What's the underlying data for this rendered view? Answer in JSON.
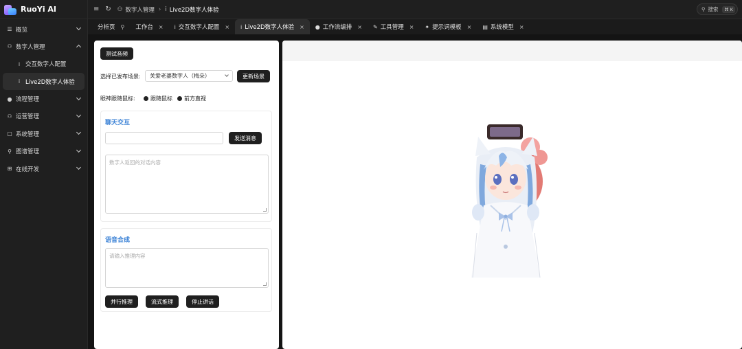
{
  "app": {
    "name": "RuoYi AI"
  },
  "sidebar": {
    "items": [
      {
        "label": "概览",
        "icon": "list-icon"
      },
      {
        "label": "数字人管理",
        "icon": "users-icon",
        "expanded": true
      },
      {
        "label": "交互数字人配置",
        "icon": "person-icon",
        "sub": true
      },
      {
        "label": "Live2D数字人体验",
        "icon": "person-icon",
        "sub": true,
        "active": true
      },
      {
        "label": "流程管理",
        "icon": "user-icon"
      },
      {
        "label": "运营管理",
        "icon": "team-icon"
      },
      {
        "label": "系统管理",
        "icon": "system-icon"
      },
      {
        "label": "图谱管理",
        "icon": "graph-icon"
      },
      {
        "label": "在线开发",
        "icon": "code-icon"
      }
    ]
  },
  "header": {
    "breadcrumb": [
      "数字人管理",
      "Live2D数字人体验"
    ],
    "search_label": "搜索",
    "search_shortcut": "⌘ K"
  },
  "tabs": [
    {
      "label": "分析页",
      "pinned": true
    },
    {
      "label": "工作台"
    },
    {
      "label": "交互数字人配置"
    },
    {
      "label": "Live2D数字人体验",
      "active": true
    },
    {
      "label": "工作流编排"
    },
    {
      "label": "工具管理"
    },
    {
      "label": "提示词模板"
    },
    {
      "label": "系统模型"
    }
  ],
  "panel": {
    "test_audio_button": "测试音频",
    "scene_label": "选择已发布场景:",
    "scene_value": "关爱老婆数字人（梅朵）",
    "update_scene_button": "更新场景",
    "eye_follow_label": "眼神跟随鼠标:",
    "eye_option_follow": "跟随鼠标",
    "eye_option_forward": "前方直视",
    "chat": {
      "title": "聊天交互",
      "send_button": "发送消息",
      "reply_placeholder": "数字人返回的对话内容"
    },
    "tts": {
      "title": "语音合成",
      "input_placeholder": "请输入推理内容",
      "parallel_button": "并行推理",
      "stream_button": "流式推理",
      "stop_button": "停止讲话"
    }
  },
  "colors": {
    "accent": "#3b82d6",
    "button": "#1f1f1f"
  }
}
